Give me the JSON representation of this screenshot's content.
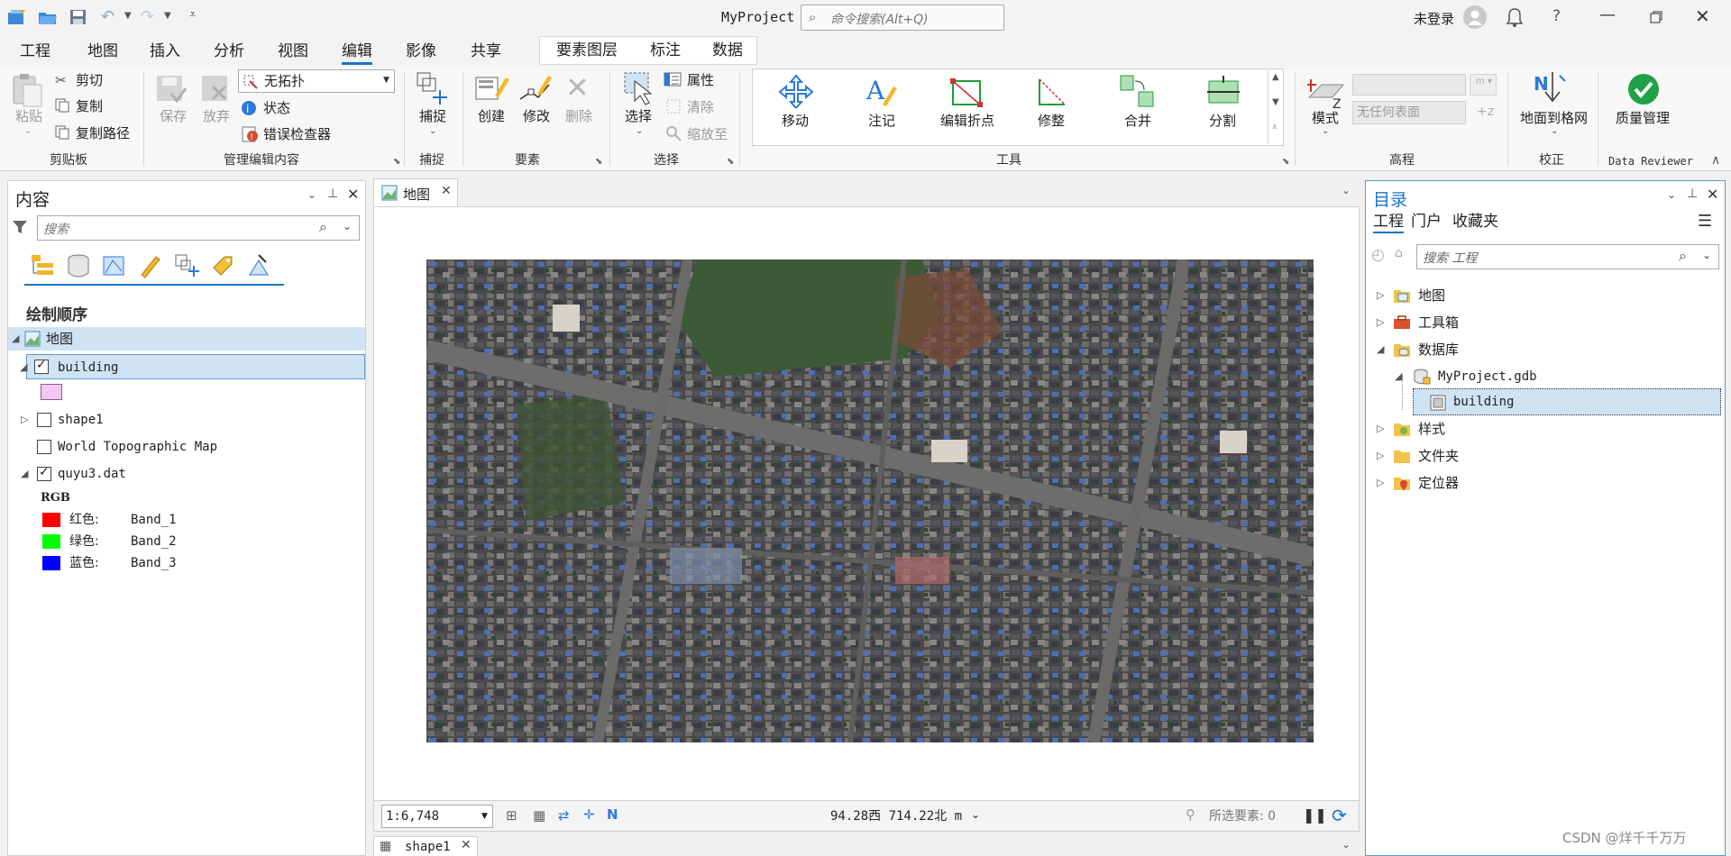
{
  "title": "MyProject",
  "command_search_placeholder": "命令搜索(Alt+Q)",
  "user": "未登录",
  "menu": [
    "工程",
    "地图",
    "插入",
    "分析",
    "视图",
    "编辑",
    "影像",
    "共享"
  ],
  "context_tabs": [
    "要素图层",
    "标注",
    "数据"
  ],
  "ribbon": {
    "clipboard": {
      "paste": "粘贴",
      "cut": "剪切",
      "copy": "复制",
      "copy_path": "复制路径",
      "group": "剪贴板"
    },
    "manage": {
      "save": "保存",
      "discard": "放弃",
      "topology": "无拓扑",
      "status": "状态",
      "error_inspector": "错误检查器",
      "group": "管理编辑内容"
    },
    "snapping": {
      "snap": "捕捉",
      "group": "捕捉"
    },
    "features": {
      "create": "创建",
      "modify": "修改",
      "delete": "删除",
      "group": "要素"
    },
    "selection": {
      "select": "选择",
      "attributes": "属性",
      "clear": "清除",
      "zoom_to": "缩放至",
      "group": "选择"
    },
    "tools": {
      "items": [
        "移动",
        "注记",
        "编辑折点",
        "修整",
        "合并",
        "分割"
      ],
      "group": "工具"
    },
    "elevation": {
      "mode": "模式",
      "surface_placeholder": "无任何表面",
      "group": "高程"
    },
    "correct": {
      "ground_to_grid": "地面到格网",
      "group": "校正"
    },
    "reviewer": {
      "quality": "质量管理",
      "group": "Data Reviewer"
    }
  },
  "contents": {
    "title": "内容",
    "search_placeholder": "搜索",
    "drawing_order": "绘制顺序",
    "map": "地图",
    "layers": {
      "building": "building",
      "shape1": "shape1",
      "topo": "World Topographic Map",
      "quyu": "quyu3.dat"
    },
    "rgb": "RGB",
    "bands": [
      {
        "label": "红色:",
        "band": "Band_1",
        "color": "#ff0000"
      },
      {
        "label": "绿色:",
        "band": "Band_2",
        "color": "#00ff00"
      },
      {
        "label": "蓝色:",
        "band": "Band_3",
        "color": "#0000ff"
      }
    ]
  },
  "map_view": {
    "tab": "地图",
    "scale": "1:6,748",
    "coords": "94.28西 714.22北 m",
    "selected": "所选要素: 0",
    "bottom_tab": "shape1"
  },
  "catalog": {
    "title": "目录",
    "tabs": [
      "工程",
      "门户",
      "收藏夹"
    ],
    "search_placeholder": "搜索 工程",
    "items": {
      "maps": "地图",
      "toolboxes": "工具箱",
      "databases": "数据库",
      "gdb": "MyProject.gdb",
      "building": "building",
      "styles": "样式",
      "folders": "文件夹",
      "locators": "定位器"
    }
  },
  "watermark": "CSDN @烊千千万万"
}
